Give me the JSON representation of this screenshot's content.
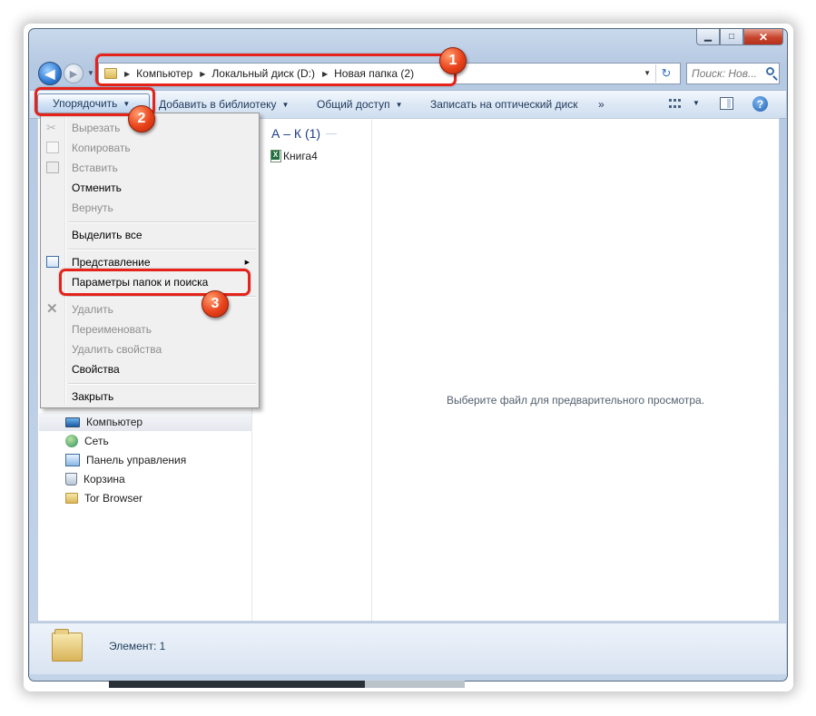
{
  "window": {
    "minimize_glyph": "▁",
    "maximize_glyph": "□",
    "close_glyph": "✕"
  },
  "nav": {
    "back_glyph": "◀",
    "forward_glyph": "▶"
  },
  "address": {
    "segments": [
      "Компьютер",
      "Локальный диск (D:)",
      "Новая папка (2)"
    ],
    "refresh_glyph": "↻"
  },
  "search": {
    "placeholder": "Поиск: Нов..."
  },
  "toolbar": {
    "organize_label": "Упорядочить",
    "add_to_library_label": "Добавить в библиотеку",
    "share_label": "Общий доступ",
    "burn_label": "Записать на оптический диск",
    "more_label": "»",
    "help_glyph": "?"
  },
  "file_list": {
    "group_header": "А – К (1)",
    "items": [
      {
        "name": "Книга4",
        "icon": "excel-icon"
      }
    ]
  },
  "preview": {
    "message": "Выберите файл для предварительного просмотра."
  },
  "nav_pane": {
    "items": [
      {
        "label": "Компьютер",
        "icon": "computer-icon",
        "selected": true
      },
      {
        "label": "Сеть",
        "icon": "network-icon"
      },
      {
        "label": "Панель управления",
        "icon": "control-panel-icon"
      },
      {
        "label": "Корзина",
        "icon": "recycle-bin-icon"
      },
      {
        "label": "Tor Browser",
        "icon": "folder-icon"
      }
    ]
  },
  "organize_menu": {
    "items": [
      {
        "label": "Вырезать",
        "enabled": false,
        "icon": "scissors-icon"
      },
      {
        "label": "Копировать",
        "enabled": false,
        "icon": "copy-icon"
      },
      {
        "label": "Вставить",
        "enabled": false,
        "icon": "paste-icon"
      },
      {
        "label": "Отменить",
        "enabled": true
      },
      {
        "label": "Вернуть",
        "enabled": false
      },
      {
        "label": "Выделить все",
        "enabled": true
      },
      {
        "label": "Представление",
        "enabled": true,
        "submenu": true,
        "icon": "layout-icon"
      },
      {
        "label": "Параметры папок и поиска",
        "enabled": true
      },
      {
        "label": "Удалить",
        "enabled": false,
        "icon": "delete-icon"
      },
      {
        "label": "Переименовать",
        "enabled": false
      },
      {
        "label": "Удалить свойства",
        "enabled": false
      },
      {
        "label": "Свойства",
        "enabled": true
      },
      {
        "label": "Закрыть",
        "enabled": true
      }
    ]
  },
  "status": {
    "text": "Элемент: 1"
  },
  "annotations": {
    "badge_1": "1",
    "badge_2": "2",
    "badge_3": "3",
    "color": "#e5231b"
  }
}
